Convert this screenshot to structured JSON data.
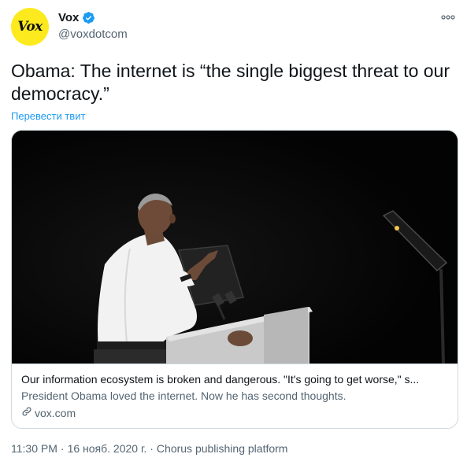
{
  "author": {
    "display_name": "Vox",
    "handle": "@voxdotcom",
    "avatar_text": "Vox",
    "verified": true
  },
  "tweet": {
    "text": "Obama: The internet is “the single biggest threat to our democracy.”",
    "translate_label": "Перевести твит"
  },
  "card": {
    "title": "Our information ecosystem is broken and dangerous. \"It's going to get worse,\" s...",
    "description": "President Obama loved the internet. Now he has second thoughts.",
    "domain": "vox.com",
    "image_icon": "photo-of-speaker-at-podium"
  },
  "meta": {
    "time": "11:30 PM",
    "separator1": "·",
    "date": "16 нояб. 2020 г.",
    "separator2": "·",
    "source": "Chorus publishing platform"
  },
  "colors": {
    "accent": "#1d9bf0",
    "avatar_bg": "#fdea1e",
    "secondary_text": "#536471"
  }
}
